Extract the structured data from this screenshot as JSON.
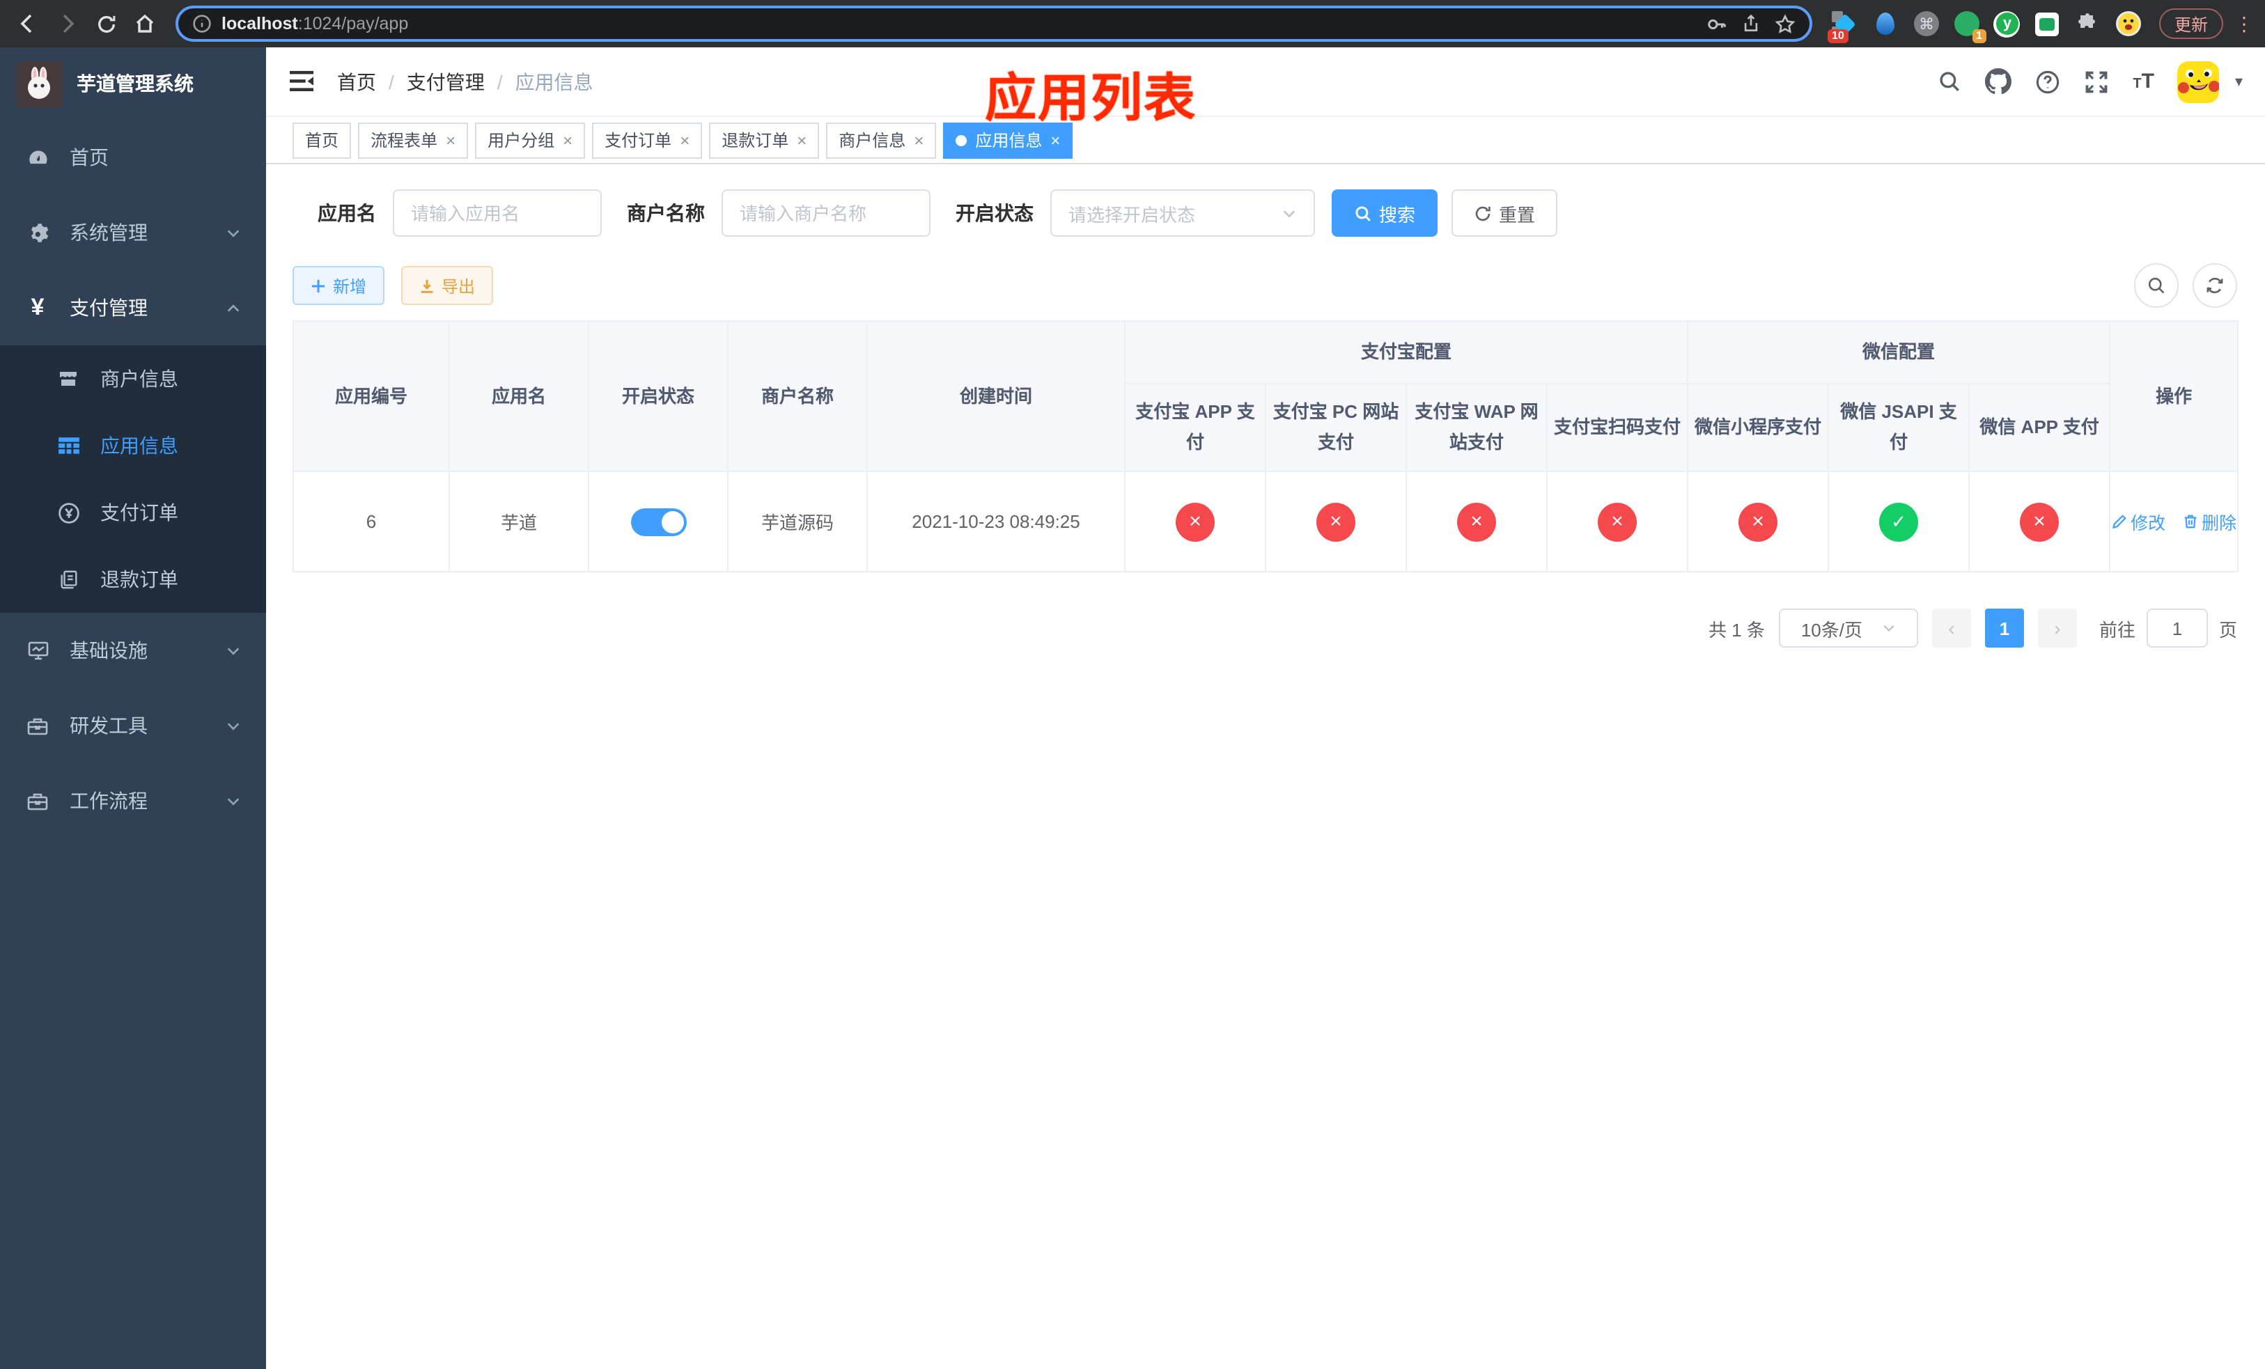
{
  "browser": {
    "url_host": "localhost",
    "url_path": ":1024/pay/app",
    "update_label": "更新",
    "ext_badge_pin": "10",
    "ext_badge_one": "1",
    "ext_y": "y",
    "ext_cmd": "⌘"
  },
  "sidebar": {
    "title": "芋道管理系统",
    "menu": [
      "首页",
      "系统管理",
      "支付管理",
      "商户信息",
      "应用信息",
      "支付订单",
      "退款订单",
      "基础设施",
      "研发工具",
      "工作流程"
    ]
  },
  "header": {
    "breadcrumb_home": "首页",
    "breadcrumb_section": "支付管理",
    "breadcrumb_current": "应用信息",
    "annotation": "应用列表"
  },
  "tabs": [
    "首页",
    "流程表单",
    "用户分组",
    "支付订单",
    "退款订单",
    "商户信息",
    "应用信息"
  ],
  "filter": {
    "app_name_label": "应用名",
    "app_name_placeholder": "请输入应用名",
    "merchant_label": "商户名称",
    "merchant_placeholder": "请输入商户名称",
    "status_label": "开启状态",
    "status_placeholder": "请选择开启状态",
    "search_label": "搜索",
    "reset_label": "重置"
  },
  "toolbar": {
    "add_label": "新增",
    "export_label": "导出"
  },
  "table": {
    "headers": {
      "app_id": "应用编号",
      "app_name": "应用名",
      "status": "开启状态",
      "merchant": "商户名称",
      "created": "创建时间",
      "group_alipay": "支付宝配置",
      "group_wechat": "微信配置",
      "actions": "操作"
    },
    "sub_headers": [
      "支付宝 APP 支付",
      "支付宝 PC 网站支付",
      "支付宝 WAP 网站支付",
      "支付宝扫码支付",
      "微信小程序支付",
      "微信 JSAPI 支付",
      "微信 APP 支付"
    ],
    "rows": [
      {
        "id": "6",
        "name": "芋道",
        "enabled": true,
        "merchant": "芋道源码",
        "created": "2021-10-23 08:49:25",
        "channels": [
          "off",
          "off",
          "off",
          "off",
          "off",
          "on",
          "off"
        ],
        "edit_label": "修改",
        "delete_label": "删除"
      }
    ]
  },
  "pagination": {
    "total": "共 1 条",
    "page_size": "10条/页",
    "current_page": "1",
    "goto_label": "前往",
    "goto_value": "1",
    "page_unit": "页"
  },
  "colors": {
    "accent": "#409eff",
    "success": "#13ce66",
    "danger": "#f5494d",
    "sidebar_bg": "#304156",
    "submenu_bg": "#1f2d3d",
    "annotation": "#ff2a00"
  }
}
